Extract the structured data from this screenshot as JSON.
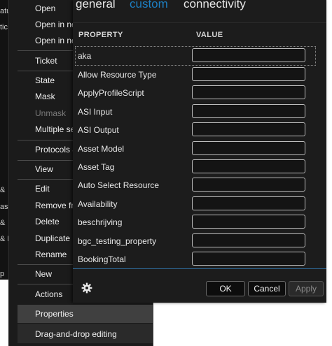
{
  "left_strip": [
    "atu",
    "tic",
    "&",
    "ast",
    "&",
    "& F",
    "p"
  ],
  "menu": {
    "items": [
      {
        "label": "Open",
        "state": "normal"
      },
      {
        "label": "Open in new",
        "state": "normal"
      },
      {
        "label": "Open in new",
        "state": "normal"
      },
      {
        "label": "Ticket",
        "state": "normal"
      },
      {
        "label": "State",
        "state": "normal"
      },
      {
        "label": "Mask",
        "state": "normal"
      },
      {
        "label": "Unmask",
        "state": "disabled"
      },
      {
        "label": "Multiple set",
        "state": "normal"
      },
      {
        "label": "Protocols & T",
        "state": "normal"
      },
      {
        "label": "View",
        "state": "normal"
      },
      {
        "label": "Edit",
        "state": "normal"
      },
      {
        "label": "Remove fron",
        "state": "normal"
      },
      {
        "label": "Delete",
        "state": "normal"
      },
      {
        "label": "Duplicate",
        "state": "normal"
      },
      {
        "label": "Rename",
        "state": "normal"
      },
      {
        "label": "New",
        "state": "normal"
      },
      {
        "label": "Actions",
        "state": "normal"
      },
      {
        "label": "Properties",
        "state": "selected"
      },
      {
        "label": "Drag-and-drop editing",
        "state": "normal"
      }
    ]
  },
  "dialog": {
    "tabs": [
      "general",
      "custom",
      "connectivity"
    ],
    "active_tab": "custom",
    "columns": {
      "property": "PROPERTY",
      "value": "VALUE"
    },
    "rows": [
      {
        "name": "aka",
        "value": ""
      },
      {
        "name": "Allow Resource Type",
        "value": ""
      },
      {
        "name": "ApplyProfileScript",
        "value": ""
      },
      {
        "name": "ASI Input",
        "value": ""
      },
      {
        "name": "ASI Output",
        "value": ""
      },
      {
        "name": "Asset Model",
        "value": ""
      },
      {
        "name": "Asset Tag",
        "value": ""
      },
      {
        "name": "Auto Select Resource",
        "value": ""
      },
      {
        "name": "Availability",
        "value": ""
      },
      {
        "name": "beschrijving",
        "value": ""
      },
      {
        "name": "bgc_testing_property",
        "value": ""
      },
      {
        "name": "BookingTotal",
        "value": ""
      }
    ],
    "buttons": {
      "ok": "OK",
      "cancel": "Cancel",
      "apply": "Apply"
    },
    "icons": {
      "settings": "gear-icon"
    },
    "colors": {
      "accent": "#1d7fc2",
      "background": "#1c1c1c"
    }
  }
}
